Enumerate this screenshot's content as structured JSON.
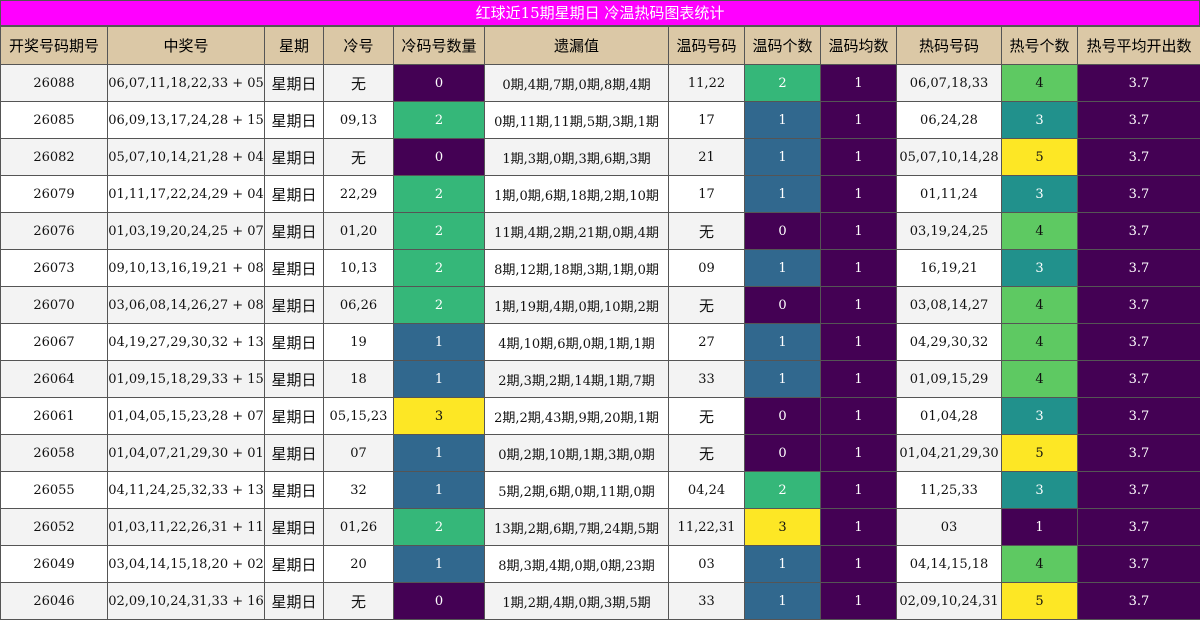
{
  "title": "红球近15期星期日 冷温热码图表统计",
  "colors": {
    "title_bg": "#ff00ff",
    "header_bg": "#dbc8a6",
    "scale": {
      "0": "#440154",
      "1": "#31688e",
      "2": "#35b779",
      "3": "#fde725",
      "3h": "#21918c",
      "4": "#5ec962",
      "5": "#fde725"
    }
  },
  "headers": [
    "开奖号码期号",
    "中奖号",
    "星期",
    "冷号",
    "冷码号数量",
    "遗漏值",
    "温码号码",
    "温码个数",
    "温码均数",
    "热码号码",
    "热号个数",
    "热号平均开出数"
  ],
  "chart_data": {
    "type": "table",
    "title": "红球近15期星期日 冷温热码图表统计",
    "columns": [
      "开奖号码期号",
      "中奖号",
      "星期",
      "冷号",
      "冷码号数量",
      "遗漏值",
      "温码号码",
      "温码个数",
      "温码均数",
      "热码号码",
      "热号个数",
      "热号平均开出数"
    ],
    "rows": [
      [
        "26088",
        "06,07,11,18,22,33 + 05",
        "星期日",
        "无",
        "0",
        "0期,4期,7期,0期,8期,4期",
        "11,22",
        "2",
        "1",
        "06,07,18,33",
        "4",
        "3.7"
      ],
      [
        "26085",
        "06,09,13,17,24,28 + 15",
        "星期日",
        "09,13",
        "2",
        "0期,11期,11期,5期,3期,1期",
        "17",
        "1",
        "1",
        "06,24,28",
        "3",
        "3.7"
      ],
      [
        "26082",
        "05,07,10,14,21,28 + 04",
        "星期日",
        "无",
        "0",
        "1期,3期,0期,3期,6期,3期",
        "21",
        "1",
        "1",
        "05,07,10,14,28",
        "5",
        "3.7"
      ],
      [
        "26079",
        "01,11,17,22,24,29 + 04",
        "星期日",
        "22,29",
        "2",
        "1期,0期,6期,18期,2期,10期",
        "17",
        "1",
        "1",
        "01,11,24",
        "3",
        "3.7"
      ],
      [
        "26076",
        "01,03,19,20,24,25 + 07",
        "星期日",
        "01,20",
        "2",
        "11期,4期,2期,21期,0期,4期",
        "无",
        "0",
        "1",
        "03,19,24,25",
        "4",
        "3.7"
      ],
      [
        "26073",
        "09,10,13,16,19,21 + 08",
        "星期日",
        "10,13",
        "2",
        "8期,12期,18期,3期,1期,0期",
        "09",
        "1",
        "1",
        "16,19,21",
        "3",
        "3.7"
      ],
      [
        "26070",
        "03,06,08,14,26,27 + 08",
        "星期日",
        "06,26",
        "2",
        "1期,19期,4期,0期,10期,2期",
        "无",
        "0",
        "1",
        "03,08,14,27",
        "4",
        "3.7"
      ],
      [
        "26067",
        "04,19,27,29,30,32 + 13",
        "星期日",
        "19",
        "1",
        "4期,10期,6期,0期,1期,1期",
        "27",
        "1",
        "1",
        "04,29,30,32",
        "4",
        "3.7"
      ],
      [
        "26064",
        "01,09,15,18,29,33 + 15",
        "星期日",
        "18",
        "1",
        "2期,3期,2期,14期,1期,7期",
        "33",
        "1",
        "1",
        "01,09,15,29",
        "4",
        "3.7"
      ],
      [
        "26061",
        "01,04,05,15,23,28 + 07",
        "星期日",
        "05,15,23",
        "3",
        "2期,2期,43期,9期,20期,1期",
        "无",
        "0",
        "1",
        "01,04,28",
        "3",
        "3.7"
      ],
      [
        "26058",
        "01,04,07,21,29,30 + 01",
        "星期日",
        "07",
        "1",
        "0期,2期,10期,1期,3期,0期",
        "无",
        "0",
        "1",
        "01,04,21,29,30",
        "5",
        "3.7"
      ],
      [
        "26055",
        "04,11,24,25,32,33 + 13",
        "星期日",
        "32",
        "1",
        "5期,2期,6期,0期,11期,0期",
        "04,24",
        "2",
        "1",
        "11,25,33",
        "3",
        "3.7"
      ],
      [
        "26052",
        "01,03,11,22,26,31 + 11",
        "星期日",
        "01,26",
        "2",
        "13期,2期,6期,7期,24期,5期",
        "11,22,31",
        "3",
        "1",
        "03",
        "1",
        "3.7"
      ],
      [
        "26049",
        "03,04,14,15,18,20 + 02",
        "星期日",
        "20",
        "1",
        "8期,3期,4期,0期,0期,23期",
        "03",
        "1",
        "1",
        "04,14,15,18",
        "4",
        "3.7"
      ],
      [
        "26046",
        "02,09,10,24,31,33 + 16",
        "星期日",
        "无",
        "0",
        "1期,2期,4期,0期,3期,5期",
        "33",
        "1",
        "1",
        "02,09,10,24,31",
        "5",
        "3.7"
      ]
    ]
  }
}
